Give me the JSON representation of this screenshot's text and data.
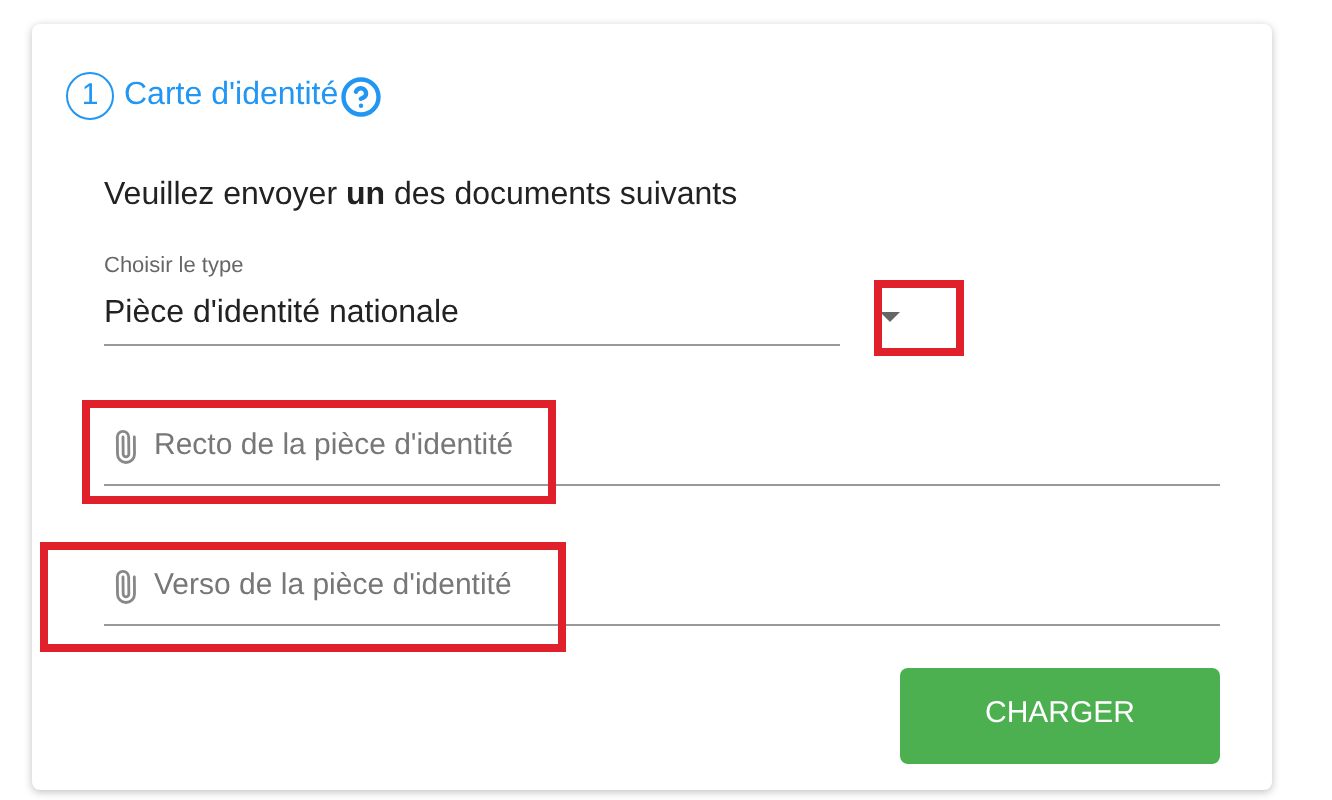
{
  "step": {
    "number": "1",
    "title": "Carte d'identité"
  },
  "instruction": "Veuillez envoyer **un** des documents suivants",
  "select": {
    "label": "Choisir le type",
    "value": "Pièce d'identité nationale",
    "highlighted": true
  },
  "uploads": [
    {
      "placeholder": "Recto de la pièce d'identité",
      "highlighted": true
    },
    {
      "placeholder": "Verso de la pièce d'identité",
      "highlighted": true
    }
  ],
  "button": "CHARGER"
}
